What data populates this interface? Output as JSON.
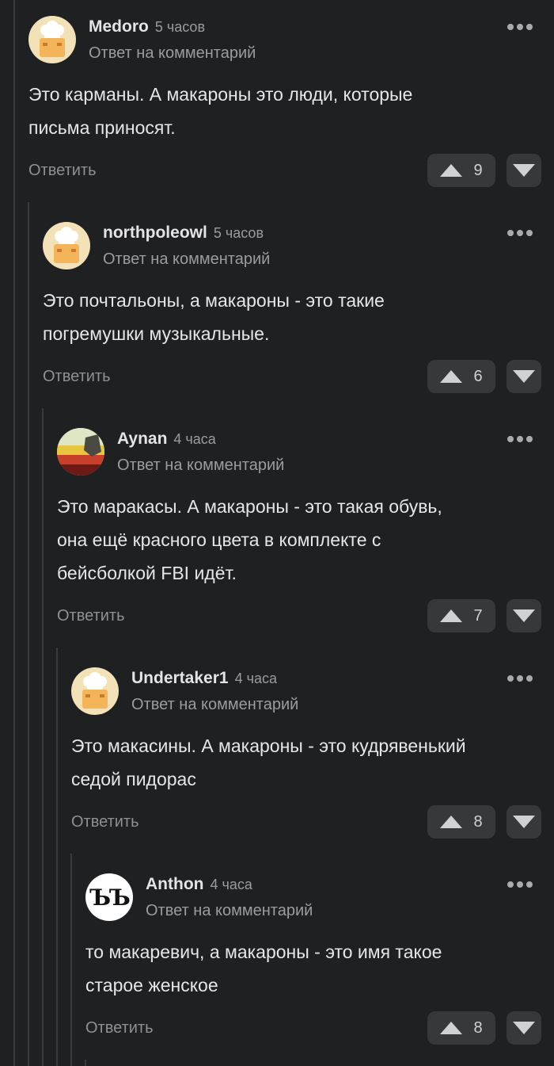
{
  "comments": [
    {
      "author": "Medoro",
      "time": "5 часов",
      "reply_to": "Ответ на комментарий",
      "lines": [
        "Это карманы. А макароны это люди, которые",
        "письма приносят."
      ],
      "reply_label": "Ответить",
      "votes": "9",
      "avatar_icon": "chef-hat-avatar-icon"
    },
    {
      "author": "northpoleowl",
      "time": "5 часов",
      "reply_to": "Ответ на комментарий",
      "lines": [
        "Это почтальоны, а макароны - это такие",
        "погремушки музыкальные."
      ],
      "reply_label": "Ответить",
      "votes": "6",
      "avatar_icon": "chef-hat-avatar-icon"
    },
    {
      "author": "Aynan",
      "time": "4 часа",
      "reply_to": "Ответ на комментарий",
      "lines": [
        "Это маракасы. А макароны - это такая обувь,",
        "она ещё красного цвета в комплекте с",
        "бейсболкой FBI идёт."
      ],
      "reply_label": "Ответить",
      "votes": "7",
      "avatar_icon": "photo-avatar-icon"
    },
    {
      "author": "Undertaker1",
      "time": "4 часа",
      "reply_to": "Ответ на комментарий",
      "lines": [
        "Это макасины. А макароны - это кудрявенький",
        "седой пидорас"
      ],
      "reply_label": "Ответить",
      "votes": "8",
      "avatar_icon": "chef-hat-avatar-icon"
    },
    {
      "author": "Anthon",
      "time": "4 часа",
      "reply_to": "Ответ на комментарий",
      "lines": [
        "то макаревич, а макароны - это имя такое",
        "старое женское"
      ],
      "reply_label": "Ответить",
      "votes": "8",
      "avatar_icon": "letters-avatar-icon",
      "avatar_text": "ЪЪ"
    }
  ],
  "colors": {
    "background": "#1e2022",
    "button_bg": "#36393c",
    "muted_text": "#9a9da0",
    "thread_line": "#383b3e"
  }
}
